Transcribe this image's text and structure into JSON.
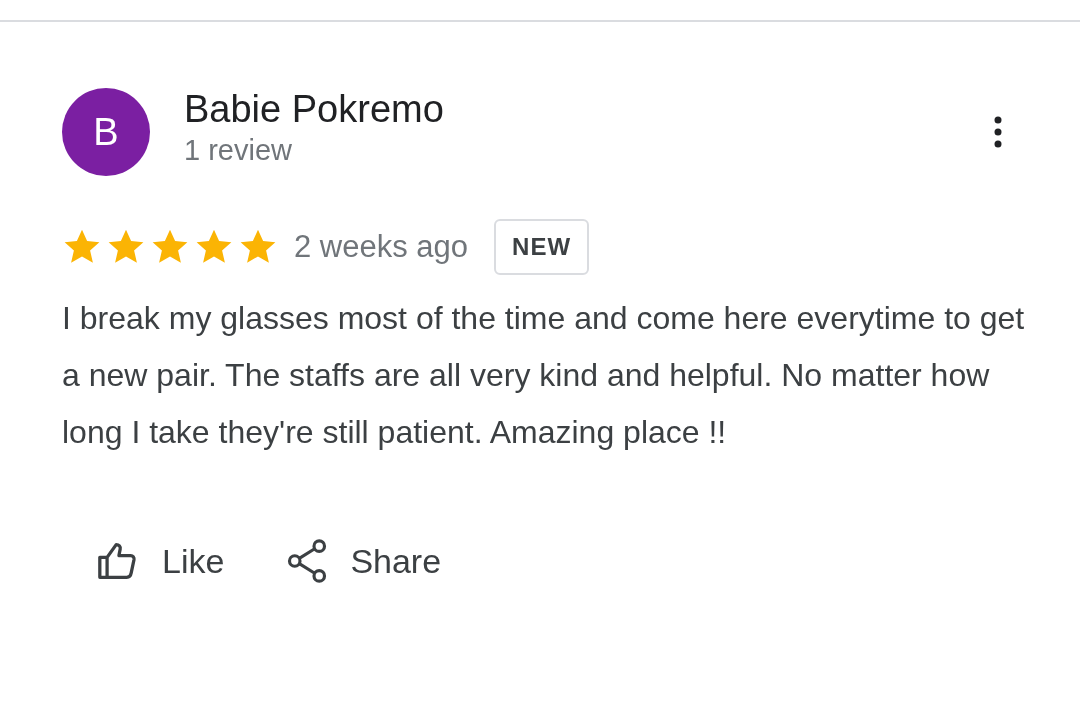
{
  "review": {
    "avatar_letter": "B",
    "author": "Babie Pokremo",
    "author_meta": "1 review",
    "stars": 5,
    "time": "2 weeks ago",
    "badge": "NEW",
    "text": "I break my glasses most of the time and come here everytime to get a new pair. The staffs are all very kind and helpful. No matter how long I take they're still patient. Amazing place !!"
  },
  "actions": [
    {
      "kind": "like",
      "label": "Like"
    },
    {
      "kind": "share",
      "label": "Share"
    }
  ]
}
